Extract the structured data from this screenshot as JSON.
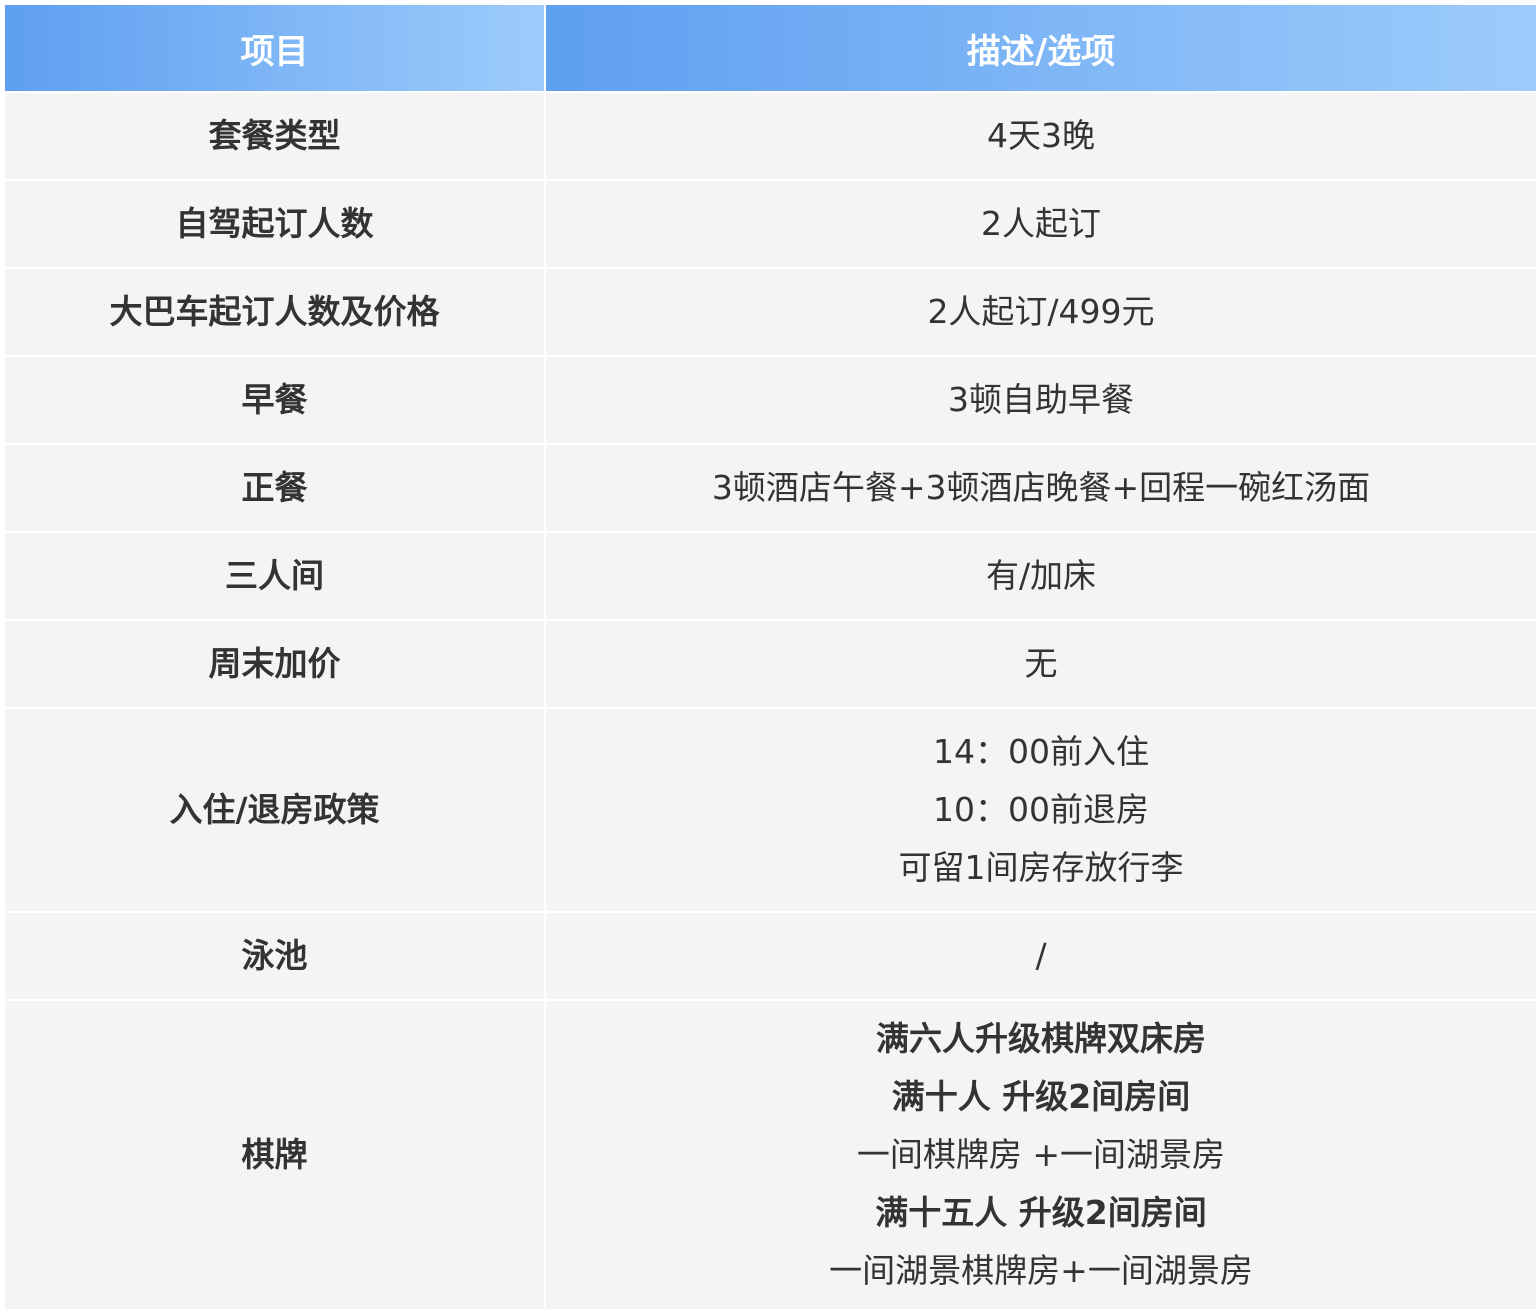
{
  "header": {
    "col1": "项目",
    "col2": "描述/选项"
  },
  "rows": [
    {
      "item": "套餐类型",
      "lines": [
        {
          "text": "4天3晚",
          "bold": false
        }
      ]
    },
    {
      "item": "自驾起订人数",
      "lines": [
        {
          "text": "2人起订",
          "bold": false
        }
      ]
    },
    {
      "item": "大巴车起订人数及价格",
      "lines": [
        {
          "text": "2人起订/499元",
          "bold": false
        }
      ]
    },
    {
      "item": "早餐",
      "lines": [
        {
          "text": "3顿自助早餐",
          "bold": false
        }
      ]
    },
    {
      "item": "正餐",
      "lines": [
        {
          "text": "3顿酒店午餐+3顿酒店晚餐+回程一碗红汤面",
          "bold": false
        }
      ]
    },
    {
      "item": "三人间",
      "lines": [
        {
          "text": "有/加床",
          "bold": false
        }
      ]
    },
    {
      "item": "周末加价",
      "lines": [
        {
          "text": "无",
          "bold": false
        }
      ]
    },
    {
      "item": "入住/退房政策",
      "lines": [
        {
          "text": "14：00前入住",
          "bold": false
        },
        {
          "text": "10：00前退房",
          "bold": false
        },
        {
          "text": "可留1间房存放行李",
          "bold": false
        }
      ]
    },
    {
      "item": "泳池",
      "lines": [
        {
          "text": "/",
          "bold": false
        }
      ]
    },
    {
      "item": "棋牌",
      "lines": [
        {
          "text": "满六人升级棋牌双床房",
          "bold": true
        },
        {
          "text": "满十人 升级2间房间",
          "bold": true
        },
        {
          "text": "一间棋牌房 +一间湖景房",
          "bold": false
        },
        {
          "text": "满十五人 升级2间房间",
          "bold": true
        },
        {
          "text": "一间湖景棋牌房+一间湖景房",
          "bold": false
        }
      ]
    }
  ],
  "colors": {
    "header_gradient_start": "#5e9ff0",
    "header_gradient_end": "#9dccfb",
    "row_background": "#f4f4f4",
    "text": "#333333"
  }
}
